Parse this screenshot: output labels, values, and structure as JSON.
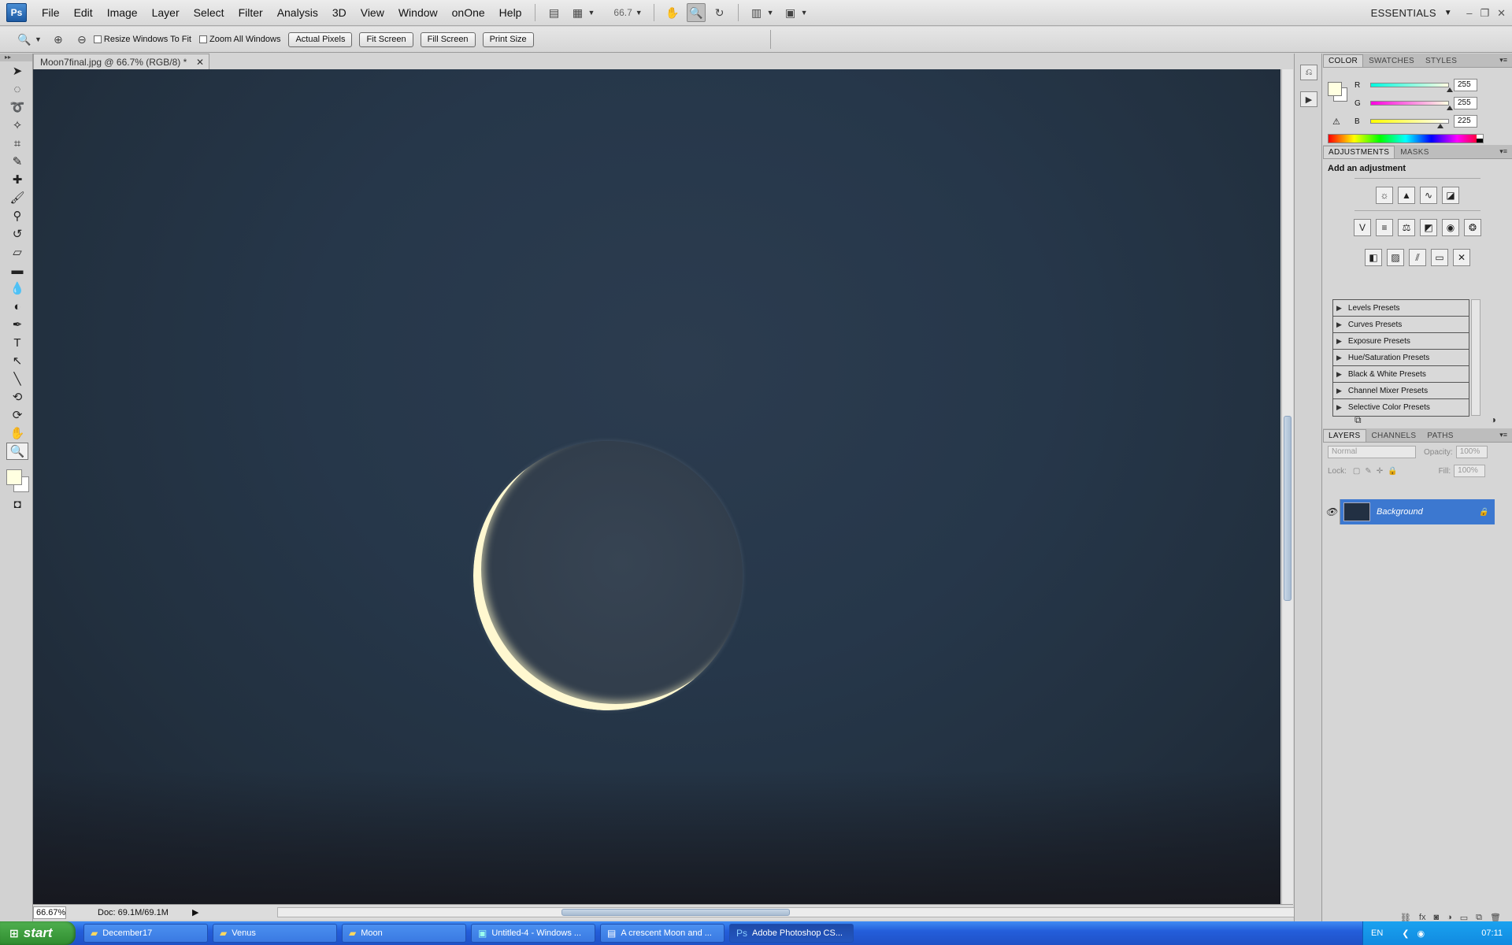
{
  "menubar": {
    "logo": "Ps",
    "items": [
      "File",
      "Edit",
      "Image",
      "Layer",
      "Select",
      "Filter",
      "Analysis",
      "3D",
      "View",
      "Window",
      "onOne",
      "Help"
    ],
    "zoom_value": "66.7",
    "workspace": "ESSENTIALS"
  },
  "options": {
    "resize_windows": "Resize Windows To Fit",
    "zoom_all": "Zoom All Windows",
    "actual_pixels": "Actual Pixels",
    "fit_screen": "Fit Screen",
    "fill_screen": "Fill Screen",
    "print_size": "Print Size"
  },
  "document": {
    "tab_title": "Moon7final.jpg @ 66.7% (RGB/8) *",
    "status_zoom": "66.67%",
    "status_doc": "Doc: 69.1M/69.1M"
  },
  "color_panel": {
    "tabs": [
      "COLOR",
      "SWATCHES",
      "STYLES"
    ],
    "r_label": "R",
    "r_value": "255",
    "g_label": "G",
    "g_value": "255",
    "b_label": "B",
    "b_value": "225",
    "foreground": "#ffffe1",
    "background": "#ffffff"
  },
  "adjustments": {
    "tabs": [
      "ADJUSTMENTS",
      "MASKS"
    ],
    "title": "Add an adjustment",
    "presets": [
      "Levels Presets",
      "Curves Presets",
      "Exposure Presets",
      "Hue/Saturation Presets",
      "Black & White Presets",
      "Channel Mixer Presets",
      "Selective Color Presets"
    ]
  },
  "layers": {
    "tabs": [
      "LAYERS",
      "CHANNELS",
      "PATHS"
    ],
    "blend_mode": "Normal",
    "opacity_label": "Opacity:",
    "opacity_value": "100%",
    "lock_label": "Lock:",
    "fill_label": "Fill:",
    "fill_value": "100%",
    "layer_name": "Background"
  },
  "taskbar": {
    "start": "start",
    "items": [
      {
        "label": "December17",
        "active": false
      },
      {
        "label": "Venus",
        "active": false
      },
      {
        "label": "Moon",
        "active": false
      },
      {
        "label": "Untitled-4 - Windows ...",
        "active": false
      },
      {
        "label": "A crescent Moon and ...",
        "active": false
      },
      {
        "label": "Adobe Photoshop CS...",
        "active": true
      }
    ],
    "lang": "EN",
    "clock": "07:11"
  }
}
